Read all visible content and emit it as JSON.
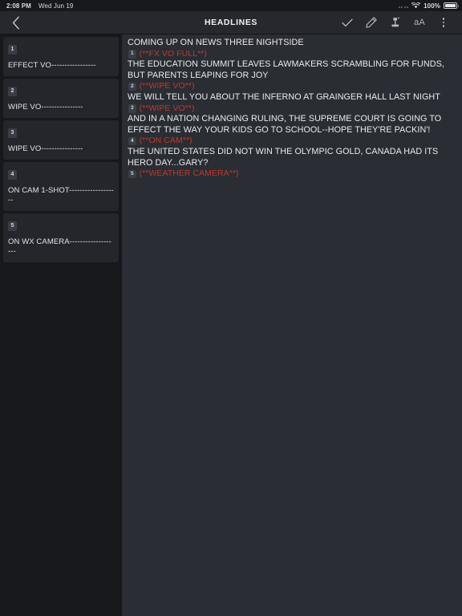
{
  "status_bar": {
    "time": "2:08 PM",
    "date": "Wed Jun 19",
    "battery_percent": "100%",
    "cellular_icon": "cellular-dots-icon",
    "wifi_icon": "wifi-icon",
    "battery_icon": "battery-full-icon"
  },
  "navbar": {
    "back_icon": "chevron-left-icon",
    "title": "HEADLINES",
    "actions": [
      {
        "name": "approve-button",
        "icon": "check-icon",
        "label": ""
      },
      {
        "name": "edit-button",
        "icon": "pencil-icon",
        "label": ""
      },
      {
        "name": "presenter-button",
        "icon": "presenter-icon",
        "label": ""
      },
      {
        "name": "text-size-button",
        "icon": "text-size-icon",
        "label": "aA"
      },
      {
        "name": "more-menu-button",
        "icon": "kebab-menu-icon",
        "label": ""
      }
    ]
  },
  "sidebar": {
    "slots": [
      {
        "number": "1",
        "title": "EFFECT VO-----------------"
      },
      {
        "number": "2",
        "title": "WIPE VO----------------"
      },
      {
        "number": "3",
        "title": "WIPE VO----------------"
      },
      {
        "number": "4",
        "title": "ON CAM 1-SHOT-------------------"
      },
      {
        "number": "5",
        "title": "ON WX CAMERA-------------------"
      }
    ]
  },
  "script": {
    "blocks": [
      {
        "text": "COMING UP ON NEWS THREE NIGHTSIDE",
        "cue_number": "1",
        "cue_text": "(**FX VO FULL**)"
      },
      {
        "text": "THE EDUCATION SUMMIT LEAVES LAWMAKERS SCRAMBLING FOR FUNDS, BUT PARENTS LEAPING FOR JOY",
        "cue_number": "2",
        "cue_text": "(**WIPE VO**)"
      },
      {
        "text": "WE WILL TELL YOU ABOUT THE INFERNO AT GRAINGER HALL LAST NIGHT",
        "cue_number": "3",
        "cue_text": "(**WIPE VO**)"
      },
      {
        "text": "AND IN A NATION CHANGING RULING, THE SUPREME COURT IS GOING TO EFFECT THE WAY YOUR KIDS GO TO SCHOOL--HOPE THEY'RE PACKIN'!",
        "cue_number": "4",
        "cue_text": "(**ON CAM**)"
      },
      {
        "text": "THE UNITED STATES DID NOT WIN THE OLYMPIC GOLD, CANADA HAD ITS HERO DAY...GARY?",
        "cue_number": "5",
        "cue_text": "(**WEATHER CAMERA**)"
      }
    ]
  },
  "colors": {
    "app_background": "#16181c",
    "navbar_background": "#26282e",
    "sidebar_background": "#16181c",
    "slot_background": "#24262b",
    "script_background": "#2a2d33",
    "cue_red": "#c0392b",
    "body_text": "#e9ebee",
    "badge_background": "#3b3e45"
  }
}
